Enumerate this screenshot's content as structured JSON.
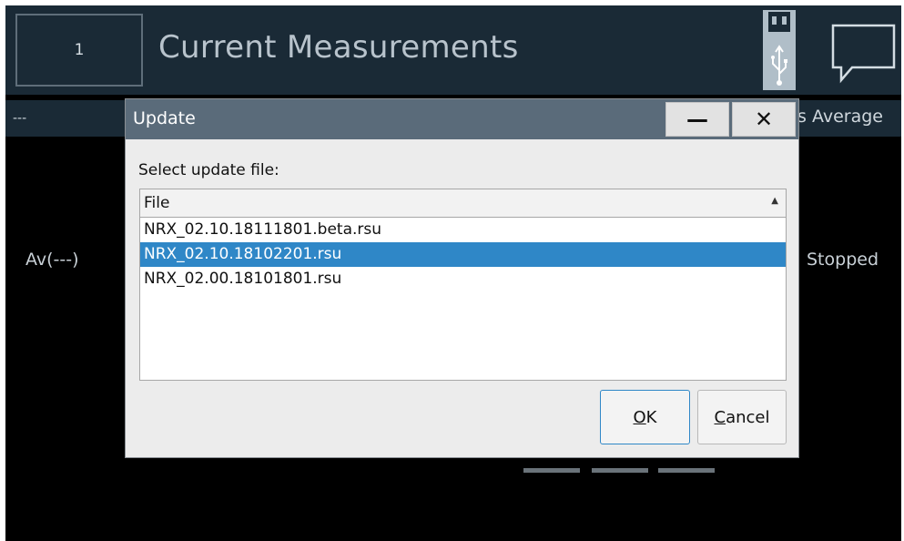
{
  "header": {
    "channel": "1",
    "title": "Current Measurements",
    "usb_icon": "usb-icon",
    "message_icon": "message-icon"
  },
  "background": {
    "left_dashes": "---",
    "average_label": "s Average",
    "av_label": "Av(---)",
    "status": "Stopped"
  },
  "dialog": {
    "title": "Update",
    "minimize_symbol": "—",
    "close_symbol": "✕",
    "prompt": "Select update file:",
    "column_header": "File",
    "sort_symbol": "▲",
    "files": [
      "NRX_02.10.18111801.beta.rsu",
      "NRX_02.10.18102201.rsu",
      "NRX_02.00.18101801.rsu"
    ],
    "selected_index": 1,
    "ok_underlined": "O",
    "ok_rest": "K",
    "cancel_underlined": "C",
    "cancel_rest": "ancel"
  },
  "colors": {
    "header_bg": "#1a2a36",
    "titlebar": "#5a6b7a",
    "selection": "#2f87c7"
  }
}
